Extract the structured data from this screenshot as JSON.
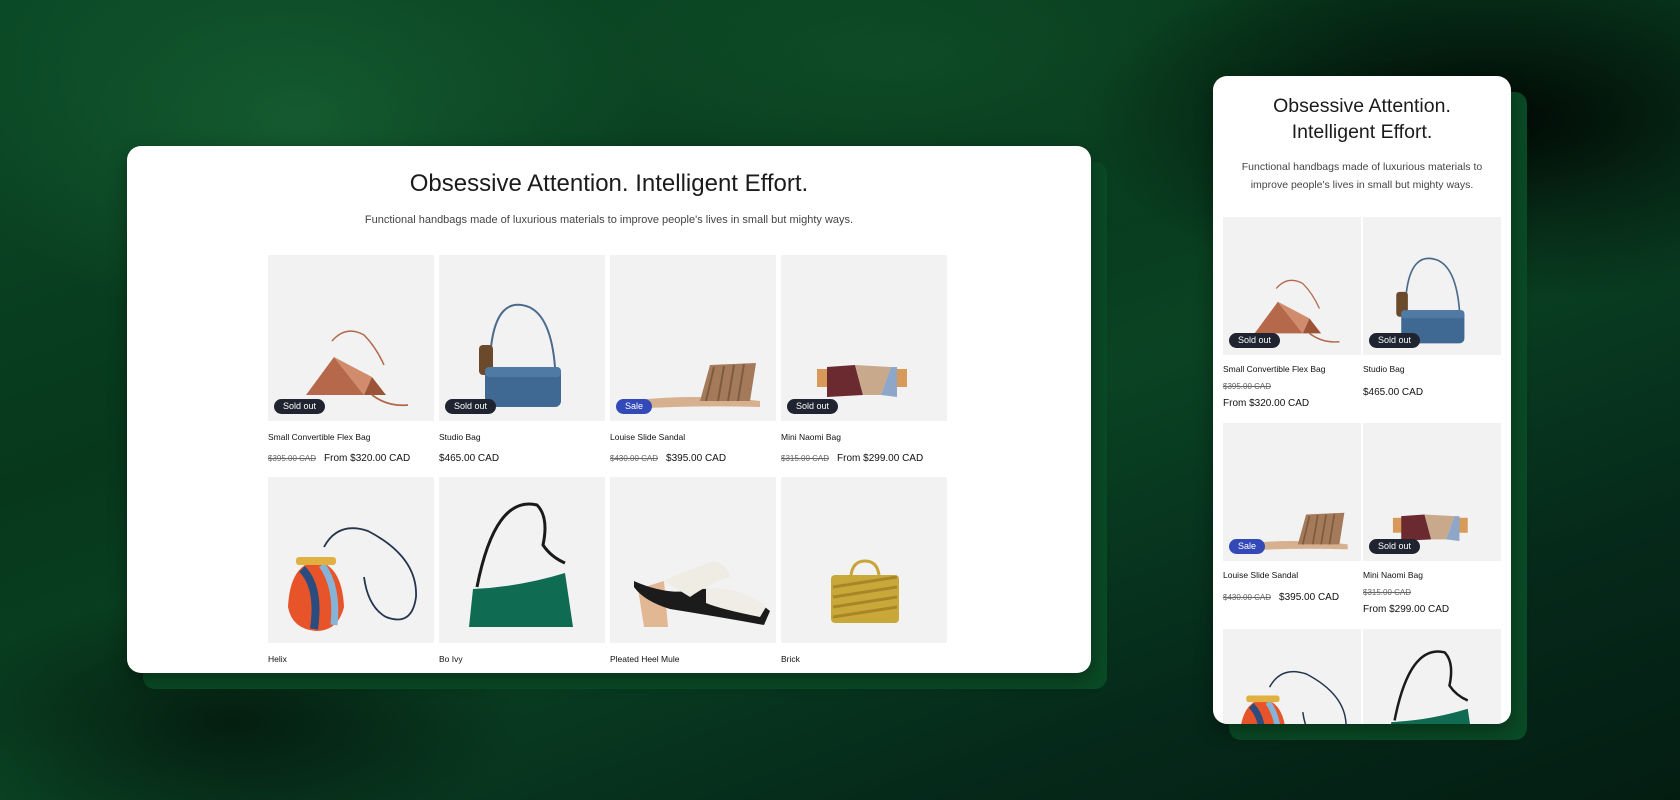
{
  "desktop": {
    "title": "Obsessive Attention. Intelligent Effort.",
    "subtitle": "Functional handbags made of luxurious materials to improve people's lives in small but mighty ways.",
    "products": [
      {
        "name": "Small Convertible Flex Bag",
        "old_price": "$395.00 CAD",
        "price": "From $320.00 CAD",
        "badge": "Sold out",
        "icon": "flex-bag"
      },
      {
        "name": "Studio Bag",
        "old_price": "",
        "price": "$465.00 CAD",
        "badge": "Sold out",
        "icon": "studio-bag"
      },
      {
        "name": "Louise Slide Sandal",
        "old_price": "$430.00 CAD",
        "price": "$395.00 CAD",
        "badge": "Sale",
        "icon": "sandal"
      },
      {
        "name": "Mini Naomi Bag",
        "old_price": "$315.00 CAD",
        "price": "From $299.00 CAD",
        "badge": "Sold out",
        "icon": "naomi-bag"
      },
      {
        "name": "Helix",
        "icon": "helix-bag"
      },
      {
        "name": "Bo Ivy",
        "icon": "bo-ivy-bag"
      },
      {
        "name": "Pleated Heel Mule",
        "icon": "mule-shoe"
      },
      {
        "name": "Brick",
        "icon": "brick-bag"
      }
    ]
  },
  "mobile": {
    "title_line1": "Obsessive Attention.",
    "title_line2": "Intelligent Effort.",
    "subtitle": "Functional handbags made of luxurious materials to improve people's lives in small but mighty ways.",
    "products": [
      {
        "name": "Small Convertible Flex Bag",
        "old_price": "$395.00 CAD",
        "price": "From $320.00 CAD",
        "badge": "Sold out"
      },
      {
        "name": "Studio Bag",
        "old_price": "",
        "price": "$465.00 CAD",
        "badge": "Sold out"
      },
      {
        "name": "Louise Slide Sandal",
        "old_price": "$430.00 CAD",
        "price": "$395.00 CAD",
        "badge": "Sale"
      },
      {
        "name": "Mini Naomi Bag",
        "old_price": "$315.00 CAD",
        "price": "From $299.00 CAD",
        "badge": "Sold out"
      }
    ]
  },
  "colors": {
    "background_green": "#0a4323",
    "badge_dark": "#1f2430",
    "badge_sale": "#3449b8",
    "card_image_bg": "#f2f2f2"
  }
}
